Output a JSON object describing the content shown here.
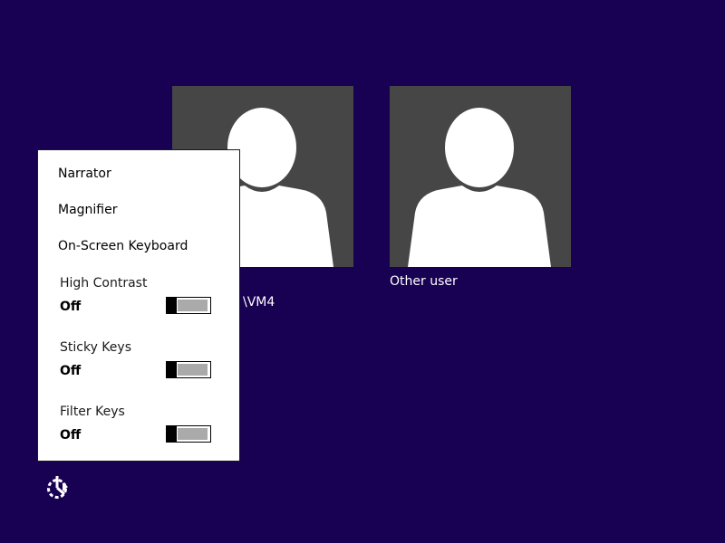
{
  "screen": {
    "background_color": "#180052",
    "tile_color": "#464646",
    "panel_background": "#ffffff"
  },
  "users": [
    {
      "label": "\\VM4"
    },
    {
      "label": "Other user"
    }
  ],
  "ease_of_access": {
    "menu_items": [
      "Narrator",
      "Magnifier",
      "On-Screen Keyboard"
    ],
    "toggles": [
      {
        "label": "High Contrast",
        "state": "Off"
      },
      {
        "label": "Sticky Keys",
        "state": "Off"
      },
      {
        "label": "Filter Keys",
        "state": "Off"
      }
    ],
    "button_icon": "ease-of-access-icon"
  }
}
